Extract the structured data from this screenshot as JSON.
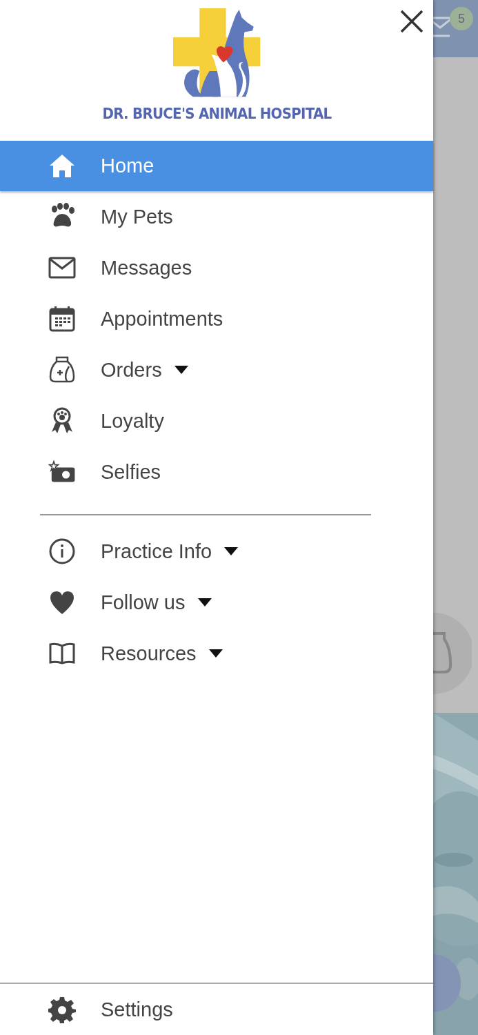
{
  "app_background": {
    "message_badge": "5"
  },
  "drawer": {
    "logo_text": "DR. BRUCE'S ANIMAL HOSPITAL",
    "menu": [
      {
        "label": "Home",
        "selected": true,
        "has_submenu": false
      },
      {
        "label": "My Pets",
        "selected": false,
        "has_submenu": false
      },
      {
        "label": "Messages",
        "selected": false,
        "has_submenu": false
      },
      {
        "label": "Appointments",
        "selected": false,
        "has_submenu": false
      },
      {
        "label": "Orders",
        "selected": false,
        "has_submenu": true
      },
      {
        "label": "Loyalty",
        "selected": false,
        "has_submenu": false
      },
      {
        "label": "Selfies",
        "selected": false,
        "has_submenu": false
      }
    ],
    "secondary_menu": [
      {
        "label": "Practice Info",
        "selected": false,
        "has_submenu": true
      },
      {
        "label": "Follow us",
        "selected": false,
        "has_submenu": true
      },
      {
        "label": "Resources",
        "selected": false,
        "has_submenu": true
      }
    ],
    "footer_item": {
      "label": "Settings"
    }
  }
}
